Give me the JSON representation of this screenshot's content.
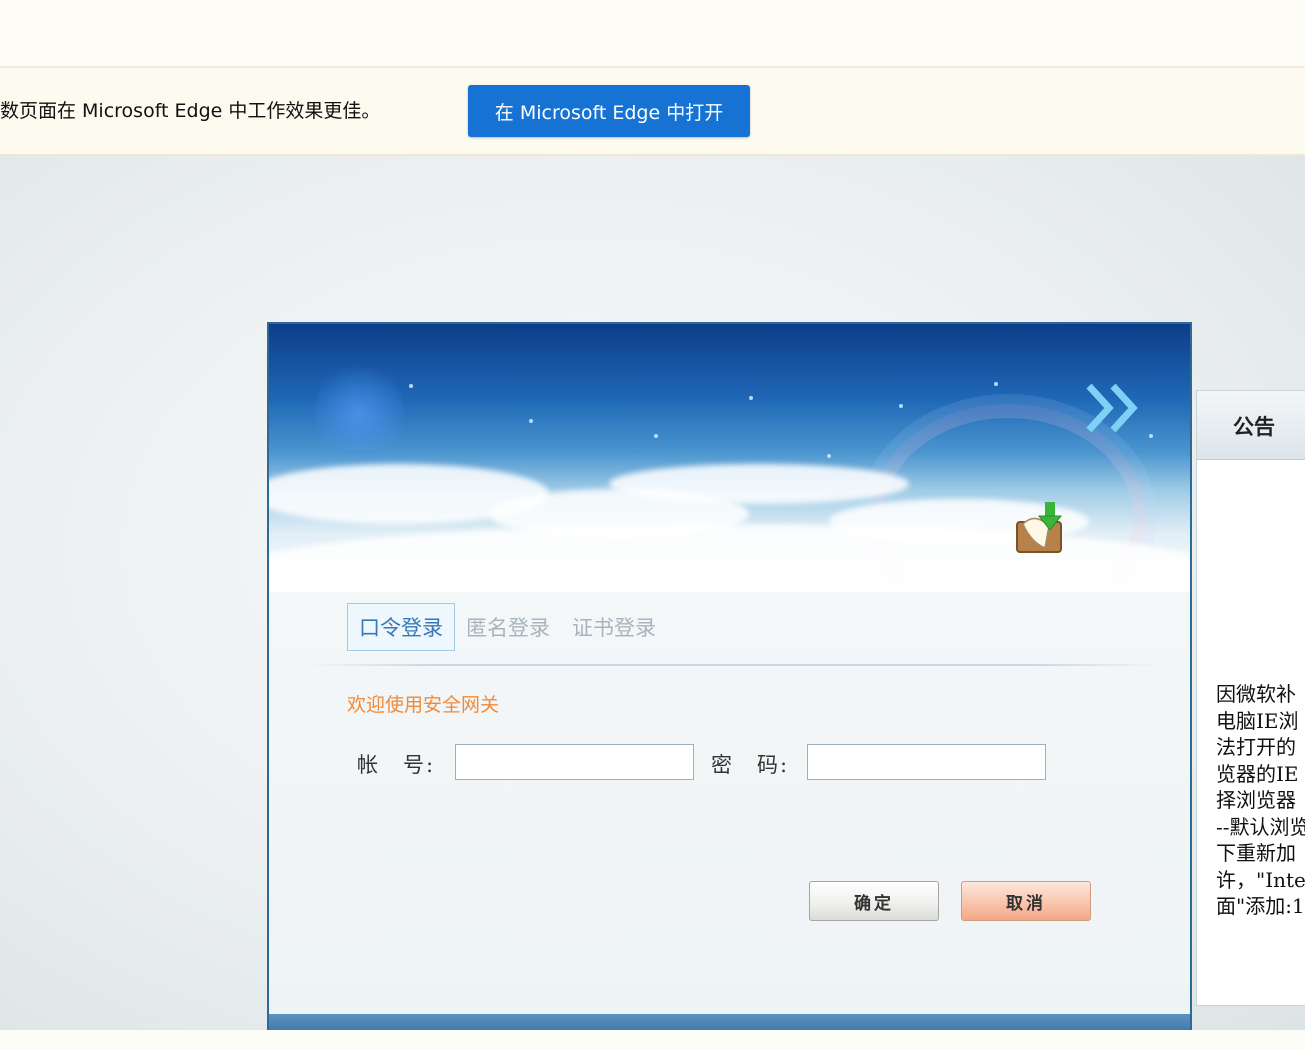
{
  "edge_bar": {
    "message": "数页面在 Microsoft Edge 中工作效果更佳。",
    "open_button": "在 Microsoft Edge 中打开"
  },
  "login": {
    "tabs": [
      {
        "label": "口令登录",
        "active": true
      },
      {
        "label": "匿名登录",
        "active": false
      },
      {
        "label": "证书登录",
        "active": false
      }
    ],
    "welcome": "欢迎使用安全网关",
    "account_label": "帐　号:",
    "account_value": "",
    "password_label": "密　码:",
    "password_value": "",
    "ok_button": "确定",
    "cancel_button": "取消"
  },
  "notice": {
    "title": "公告",
    "lines": [
      "因微软补",
      "电脑IE浏",
      "法打开的",
      "览器的IE",
      "择浏览器",
      "--默认浏览",
      "下重新加",
      "许，\"Inte",
      "面\"添加:1"
    ]
  },
  "colors": {
    "edge_button": "#1673d3",
    "active_tab": "#3777b6",
    "welcome_text": "#f08a3a",
    "cancel_button": "#f8c2a8"
  }
}
